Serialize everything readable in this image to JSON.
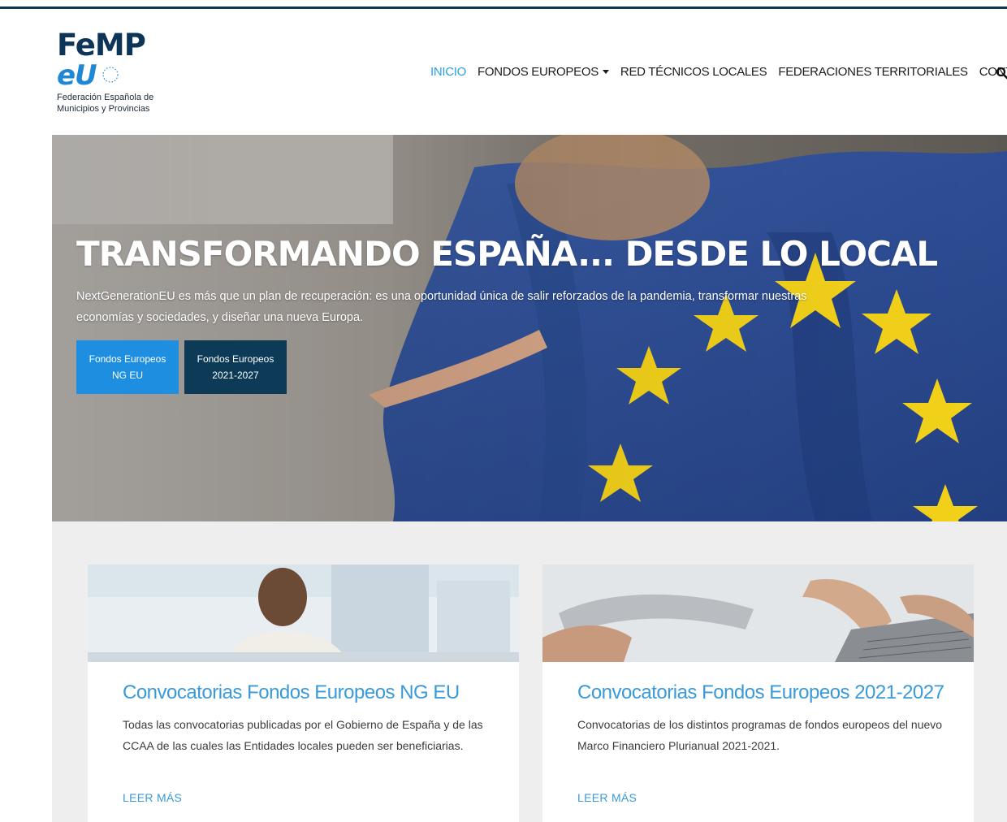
{
  "header": {
    "logo": {
      "line1": "FeMP",
      "line2": "eU",
      "subtitle_line1": "Federación Española de",
      "subtitle_line2": "Municipios y Provincias"
    },
    "nav": {
      "items": [
        {
          "label": "INICIO",
          "active": true
        },
        {
          "label": "FONDOS EUROPEOS",
          "has_dropdown": true
        },
        {
          "label": "RED TÉCNICOS LOCALES"
        },
        {
          "label": "FEDERACIONES TERRITORIALES"
        },
        {
          "label": "CONTACTO"
        }
      ],
      "search_icon": "search-icon"
    }
  },
  "hero": {
    "title": "TRANSFORMANDO ESPAÑA... DESDE LO LOCAL",
    "text": "NextGenerationEU es más que un plan de recuperación: es una oportunidad única de salir reforzados de la pandemia, transformar nuestras economías y sociedades, y diseñar una nueva Europa.",
    "buttons": [
      {
        "label": "Fondos Europeos NG EU"
      },
      {
        "label": "Fondos Europeos 2021-2027"
      }
    ]
  },
  "cards": [
    {
      "title": "Convocatorias Fondos Europeos NG EU",
      "description": "Todas las convocatorias publicadas por el Gobierno de España y de las CCAA de las cuales las Entidades locales pueden ser beneficiarias.",
      "link": "LEER MÁS"
    },
    {
      "title": "Convocatorias Fondos Europeos 2021-2027",
      "description": "Convocatorias de los distintos programas de fondos europeos del nuevo Marco Financiero Plurianual 2021-2021.",
      "link": "LEER MÁS"
    }
  ],
  "colors": {
    "accent": "#2aa0e4",
    "navy": "#0d3a57",
    "button_primary": "#1e8fe0",
    "flag_blue": "#2d4a8a",
    "star_yellow": "#f3d21a"
  }
}
